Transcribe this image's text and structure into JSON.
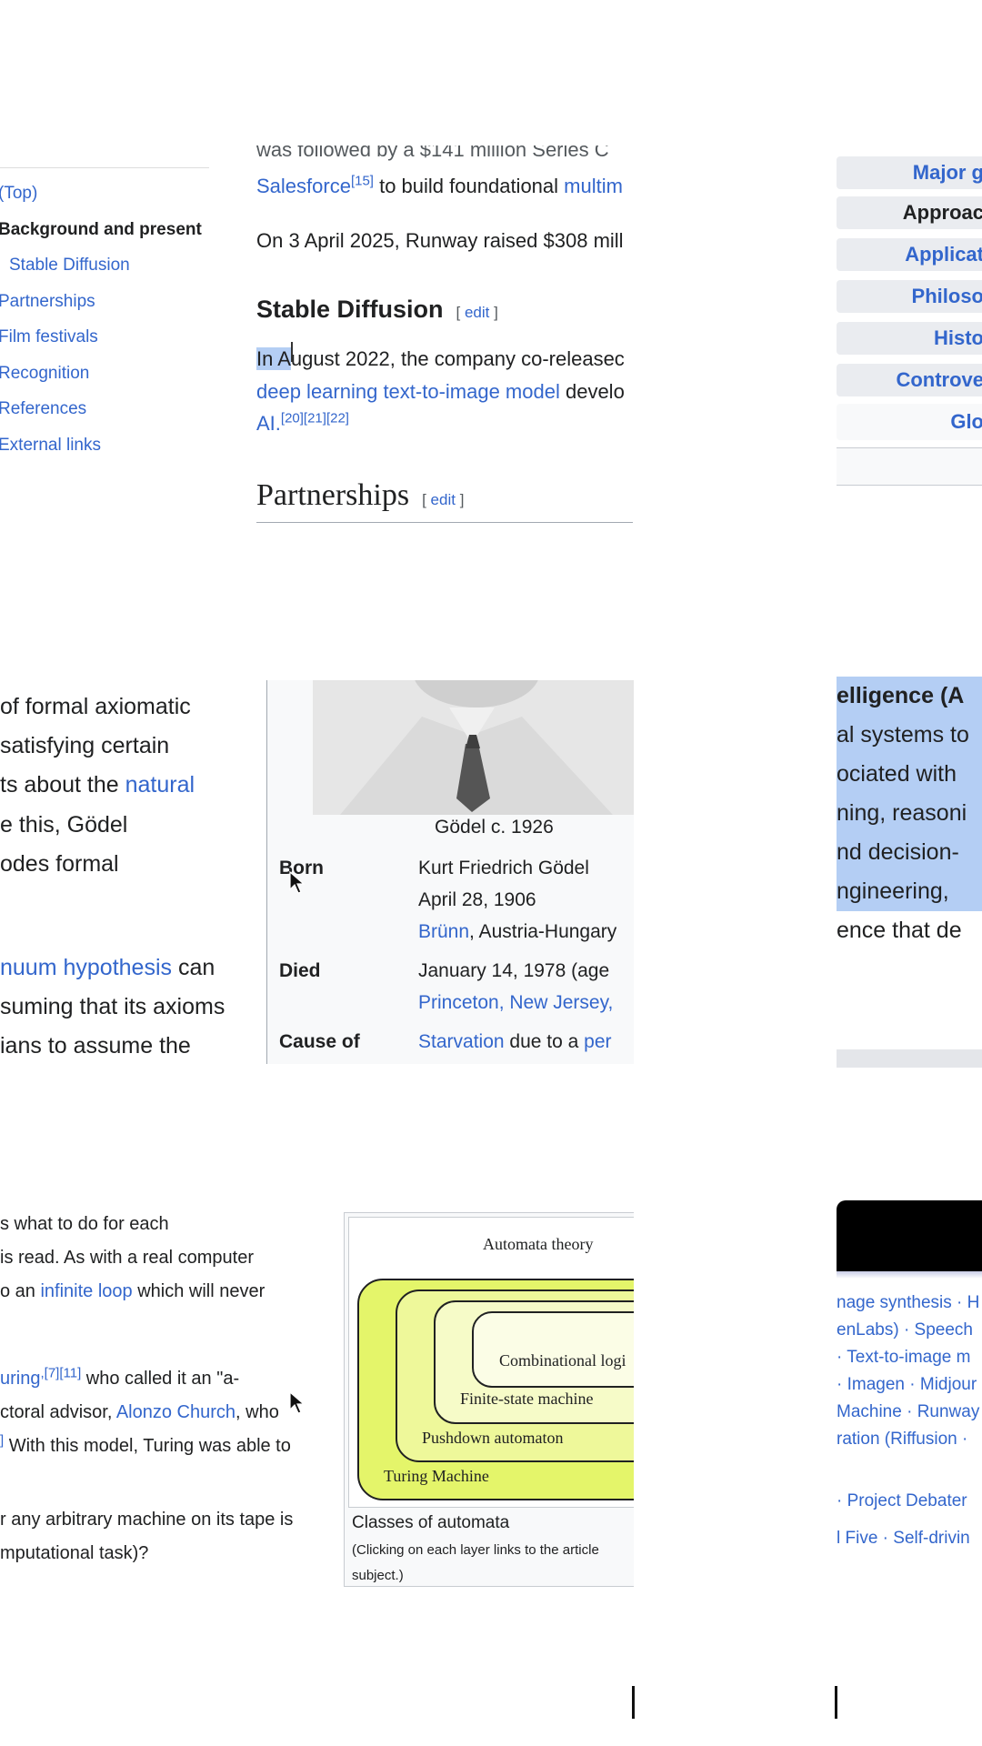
{
  "toc": {
    "items": [
      {
        "label": "(Top)",
        "bold": false,
        "indent": false
      },
      {
        "label": "Background and present",
        "bold": true,
        "indent": false
      },
      {
        "label": "Stable Diffusion",
        "bold": false,
        "indent": true
      },
      {
        "label": "Partnerships",
        "bold": false,
        "indent": false
      },
      {
        "label": "Film festivals",
        "bold": false,
        "indent": false
      },
      {
        "label": "Recognition",
        "bold": false,
        "indent": false
      },
      {
        "label": "References",
        "bold": false,
        "indent": false
      },
      {
        "label": "External links",
        "bold": false,
        "indent": false
      }
    ]
  },
  "runway_article": {
    "cut_top_text": "was followed by a $141 million Series C",
    "line1_link": "Salesforce",
    "line1_ref": "[15]",
    "line1_text": " to build foundational ",
    "line1_link2": "multim",
    "line2_text": "On 3 April 2025, Runway raised $308 mill",
    "section_heading": "Stable Diffusion",
    "edit_label": "edit",
    "sd_line1_selected": "In A",
    "sd_line1_rest": "ugust 2022, the company co-releasec",
    "sd_line2_link": "deep learning text-to-image model",
    "sd_line2_rest": " develo",
    "sd_line3_link": "AI.",
    "sd_line3_refs": "[20][21][22]",
    "partnerships_heading": "Partnerships"
  },
  "nav_box": {
    "rows": [
      {
        "label": "Major g",
        "plain": false
      },
      {
        "label": "Approac",
        "plain": true
      },
      {
        "label": "Applicat",
        "plain": false
      },
      {
        "label": "Philoso",
        "plain": false
      },
      {
        "label": "Histo",
        "plain": false
      },
      {
        "label": "Controve",
        "plain": false
      },
      {
        "label": "Glo",
        "plain": false
      }
    ]
  },
  "godel_text": {
    "lines": [
      {
        "pre": "of formal axiomatic",
        "link": "",
        "post": ""
      },
      {
        "pre": "satisfying certain",
        "link": "",
        "post": ""
      },
      {
        "pre": "ts about the ",
        "link": "natural",
        "post": ""
      },
      {
        "pre": "e this, Gödel",
        "link": "",
        "post": ""
      },
      {
        "pre": "odes formal",
        "link": "",
        "post": ""
      }
    ],
    "lines2": [
      {
        "pre": "",
        "link": "nuum hypothesis",
        "post": " can"
      },
      {
        "pre": "suming that its axioms",
        "link": "",
        "post": ""
      },
      {
        "pre": "ians to assume the",
        "link": "",
        "post": ""
      }
    ]
  },
  "infobox": {
    "caption": "Gödel c. 1926",
    "born_label": "Born",
    "born_name": "Kurt Friedrich Gödel",
    "born_date": "April 28, 1906",
    "born_place_link": "Brünn",
    "born_place_rest": ", Austria-Hungary",
    "died_label": "Died",
    "died_date": "January 14, 1978 (age",
    "died_place_link": "Princeton, New Jersey,",
    "cause_label": "Cause of",
    "cause_link": "Starvation",
    "cause_rest": " due to a ",
    "cause_link2": "per"
  },
  "ai_snippet": {
    "lines": [
      {
        "text": "elligence",
        "bold": true,
        "suffix": " (A",
        "hl": true
      },
      {
        "text": "al systems to",
        "bold": false,
        "suffix": "",
        "hl": true
      },
      {
        "text": "ociated with",
        "bold": false,
        "suffix": "",
        "hl": true
      },
      {
        "text": "ning, reasoni",
        "bold": false,
        "suffix": "",
        "hl": true
      },
      {
        "text": "nd decision-",
        "bold": false,
        "suffix": "",
        "hl": true
      },
      {
        "text": "ngineering, ",
        "bold": false,
        "suffix": "",
        "hl": true
      },
      {
        "text": "ence that de",
        "bold": false,
        "suffix": "",
        "hl": false
      }
    ]
  },
  "turing_text": {
    "l1": "s what to do for each",
    "l2": "is read. As with a real computer",
    "l3_pre": "o an ",
    "l3_link": "infinite loop",
    "l3_post": " which will never",
    "l4_link": "uring",
    "l4_refs": ",[7][11]",
    "l4_post": " who called it an \"a-",
    "l5_pre": "ctoral advisor, ",
    "l5_link": "Alonzo Church",
    "l5_post": ", who",
    "l6_ref": "]",
    "l6_post": " With this model, Turing was able to",
    "l7": "r any arbitrary machine on its tape is",
    "l8": "mputational task)?"
  },
  "automata": {
    "title": "Automata theory",
    "layers": [
      "Combinational logi",
      "Finite-state machine",
      "Pushdown automaton",
      "Turing Machine"
    ],
    "caption": "Classes of automata",
    "subcaption": "(Clicking on each layer links to the article",
    "subcaption2": "subject.)",
    "colors": {
      "outer": "#e4f56a",
      "mid": "#eef89a",
      "inner": "#f6fbc8",
      "innermost": "#fbfde6"
    }
  },
  "footer_nav": {
    "lines": [
      "nage synthesis · H",
      "enLabs) · Speech",
      "· Text-to-image m",
      "· Imagen · Midjour",
      "Machine · Runway",
      "ration (Riffusion ·",
      "· Project Debater",
      "l Five · Self-drivin"
    ]
  }
}
